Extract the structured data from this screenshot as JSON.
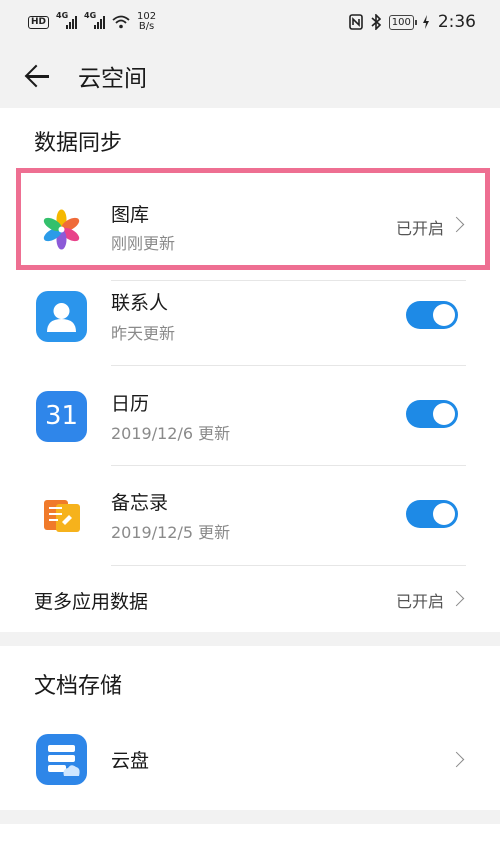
{
  "status_bar": {
    "hd": "HD",
    "sim1": "4G",
    "sim2": "4G",
    "speed_value": "102",
    "speed_unit": "B/s",
    "battery": "100",
    "time": "2:36"
  },
  "header": {
    "title": "云空间"
  },
  "data_sync": {
    "title": "数据同步",
    "gallery": {
      "name": "图库",
      "sub": "刚刚更新",
      "status": "已开启"
    },
    "contacts": {
      "name": "联系人",
      "sub": "昨天更新",
      "toggle_on": true
    },
    "calendar": {
      "name": "日历",
      "sub": "2019/12/6 更新",
      "icon_text": "31",
      "toggle_on": true
    },
    "notes": {
      "name": "备忘录",
      "sub": "2019/12/5 更新",
      "toggle_on": true
    },
    "more": {
      "name": "更多应用数据",
      "status": "已开启"
    }
  },
  "doc_storage": {
    "title": "文档存储",
    "drive": {
      "name": "云盘"
    }
  },
  "colors": {
    "accent": "#1e8ae6",
    "highlight": "#ee6f92"
  }
}
